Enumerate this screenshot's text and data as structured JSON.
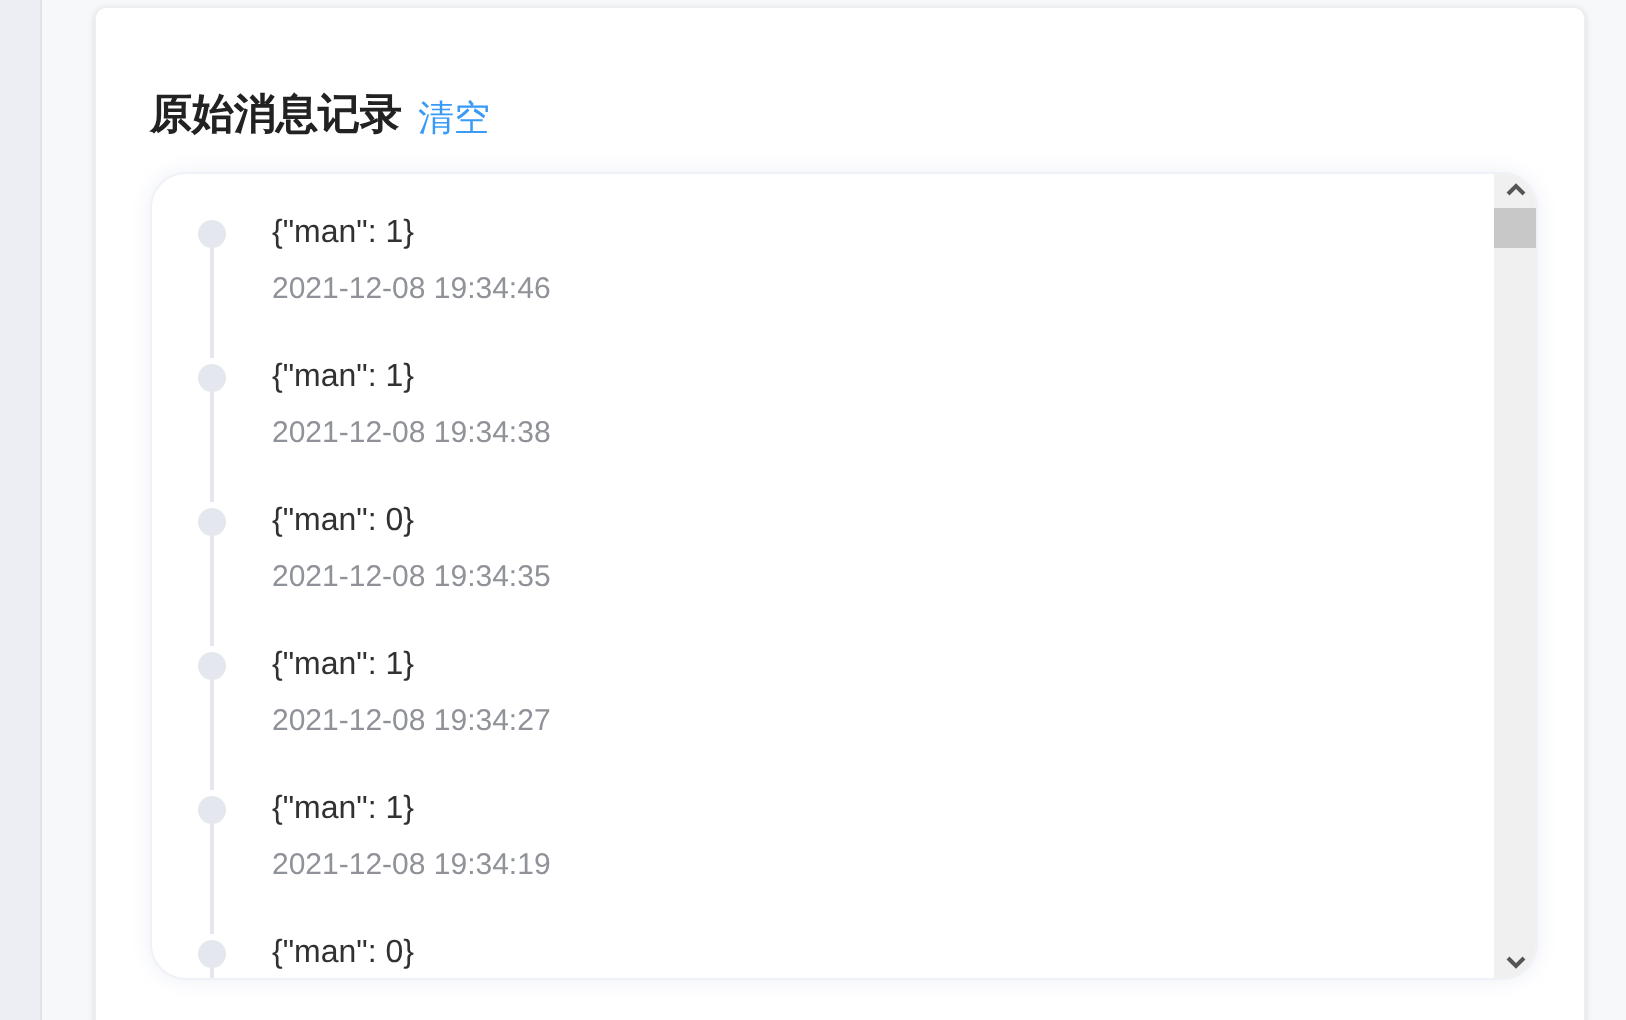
{
  "panel": {
    "title": "原始消息记录",
    "clear_link": "清空"
  },
  "messages": [
    {
      "content": "{\"man\": 1}",
      "time": "2021-12-08 19:34:46"
    },
    {
      "content": "{\"man\": 1}",
      "time": "2021-12-08 19:34:38"
    },
    {
      "content": "{\"man\": 0}",
      "time": "2021-12-08 19:34:35"
    },
    {
      "content": "{\"man\": 1}",
      "time": "2021-12-08 19:34:27"
    },
    {
      "content": "{\"man\": 1}",
      "time": "2021-12-08 19:34:19"
    },
    {
      "content": "{\"man\": 0}"
    }
  ]
}
